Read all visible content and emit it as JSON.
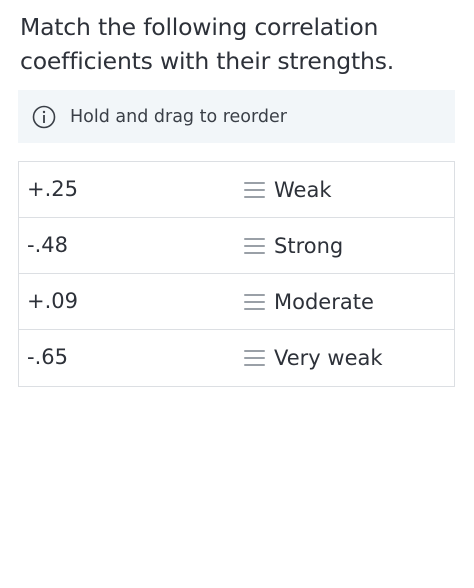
{
  "question": {
    "text": "Match the following correlation coefficients with their strengths."
  },
  "hint": {
    "icon": "info-circle-icon",
    "text": "Hold and drag to reorder"
  },
  "rows": [
    {
      "coefficient": "+.25",
      "strength": "Weak"
    },
    {
      "coefficient": "-.48",
      "strength": "Strong"
    },
    {
      "coefficient": "+.09",
      "strength": "Moderate"
    },
    {
      "coefficient": "-.65",
      "strength": "Very weak"
    }
  ]
}
